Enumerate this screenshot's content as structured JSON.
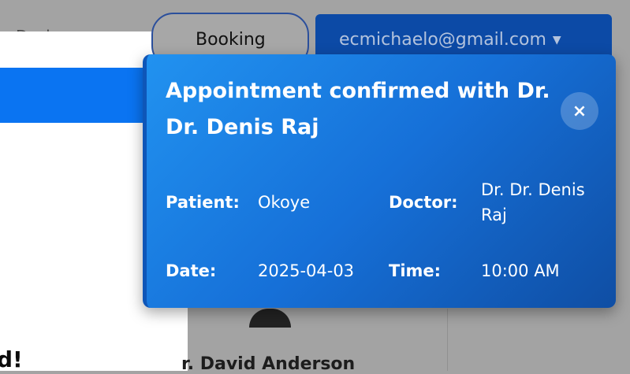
{
  "background": {
    "faint_text": "Dasi",
    "booking_label": "Booking",
    "email": "ecmichaelo@gmail.com",
    "partial_heading": "d!",
    "doctor_name": "r. David Anderson"
  },
  "modal": {
    "title": "Appointment confirmed with Dr. Dr. Denis Raj",
    "close_symbol": "×",
    "patient_label": "Patient:",
    "patient_value": "Okoye",
    "doctor_label": "Doctor:",
    "doctor_value": "Dr. Dr. Denis Raj",
    "date_label": "Date:",
    "date_value": "2025-04-03",
    "time_label": "Time:",
    "time_value": "10:00 AM"
  }
}
